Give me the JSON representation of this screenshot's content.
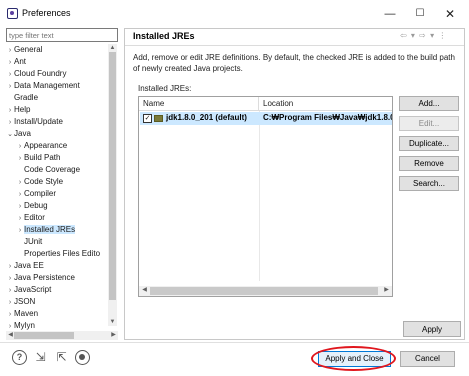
{
  "window": {
    "title": "Preferences",
    "controls": {
      "minimize": "—",
      "maximize": "☐",
      "close": "✕"
    }
  },
  "sidebar": {
    "filter_placeholder": "type filter text",
    "items": [
      {
        "label": "General",
        "expander": "›"
      },
      {
        "label": "Ant",
        "expander": "›"
      },
      {
        "label": "Cloud Foundry",
        "expander": "›"
      },
      {
        "label": "Data Management",
        "expander": "›"
      },
      {
        "label": "Gradle",
        "expander": ""
      },
      {
        "label": "Help",
        "expander": "›"
      },
      {
        "label": "Install/Update",
        "expander": "›"
      },
      {
        "label": "Java",
        "expander": "⌄"
      },
      {
        "label": "Appearance",
        "expander": "›"
      },
      {
        "label": "Build Path",
        "expander": "›"
      },
      {
        "label": "Code Coverage",
        "expander": ""
      },
      {
        "label": "Code Style",
        "expander": "›"
      },
      {
        "label": "Compiler",
        "expander": "›"
      },
      {
        "label": "Debug",
        "expander": "›"
      },
      {
        "label": "Editor",
        "expander": "›"
      },
      {
        "label": "Installed JREs",
        "expander": "›",
        "selected": true
      },
      {
        "label": "JUnit",
        "expander": ""
      },
      {
        "label": "Properties Files Edito",
        "expander": ""
      },
      {
        "label": "Java EE",
        "expander": "›"
      },
      {
        "label": "Java Persistence",
        "expander": "›"
      },
      {
        "label": "JavaScript",
        "expander": "›"
      },
      {
        "label": "JSON",
        "expander": "›"
      },
      {
        "label": "Maven",
        "expander": "›"
      },
      {
        "label": "Mylyn",
        "expander": "›"
      }
    ],
    "scroll_up": "▲",
    "scroll_down": "▼",
    "scroll_left": "◀",
    "scroll_right": "▶"
  },
  "page": {
    "title": "Installed JREs",
    "nav_arrows": "⇦ ▾ ⇨ ▾ ⋮",
    "description": "Add, remove or edit JRE definitions. By default, the checked JRE is added to the build path of newly created Java projects.",
    "installed_label": "Installed JREs:",
    "table": {
      "columns": [
        "Name",
        "Location"
      ],
      "rows": [
        {
          "checked": true,
          "check_glyph": "✓",
          "name": "jdk1.8.0_201 (default)",
          "location": "C:₩Program Files₩Java₩jdk1.8.0_2"
        }
      ],
      "scroll_left": "◀",
      "scroll_right": "▶"
    },
    "buttons": {
      "add": "Add...",
      "edit": "Edit...",
      "duplicate": "Duplicate...",
      "remove": "Remove",
      "search": "Search..."
    },
    "apply": "Apply"
  },
  "footer": {
    "help_glyph": "?",
    "import_glyph": "⇲",
    "export_glyph": "⇱",
    "apply_and_close": "Apply and Close",
    "cancel": "Cancel"
  },
  "colors": {
    "selection": "#cce8ff",
    "highlight_annotation": "#e0161d",
    "default_button_border": "#0078d7"
  },
  "icons": [
    "eclipse-icon",
    "help-icon",
    "import-icon",
    "export-icon",
    "record-icon",
    "jre-icon",
    "checkbox-checked-icon"
  ]
}
